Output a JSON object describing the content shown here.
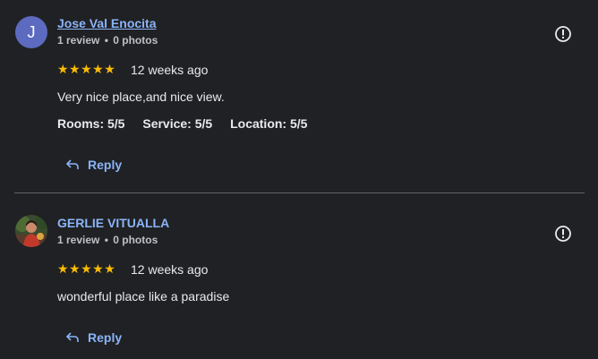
{
  "reviews": [
    {
      "name": "Jose Val Enocita",
      "avatar_letter": "J",
      "review_count": "1 review",
      "photo_count": "0 photos",
      "stars": "★★★★★",
      "time": "12 weeks ago",
      "text": "Very nice place,and nice view.",
      "ratings": [
        "Rooms: 5/5",
        "Service: 5/5",
        "Location: 5/5"
      ],
      "reply_label": "Reply"
    },
    {
      "name": "GERLIE VITUALLA",
      "review_count": "1 review",
      "photo_count": "0 photos",
      "stars": "★★★★★",
      "time": "12 weeks ago",
      "text": "wonderful place like a paradise",
      "reply_label": "Reply"
    }
  ],
  "separator": "•",
  "colors": {
    "background": "#202124",
    "link": "#8ab4f8",
    "star": "#fbbc04",
    "avatar": "#5c6bc0"
  },
  "icons": {
    "flag": "report-icon",
    "reply": "reply-arrow-icon"
  }
}
